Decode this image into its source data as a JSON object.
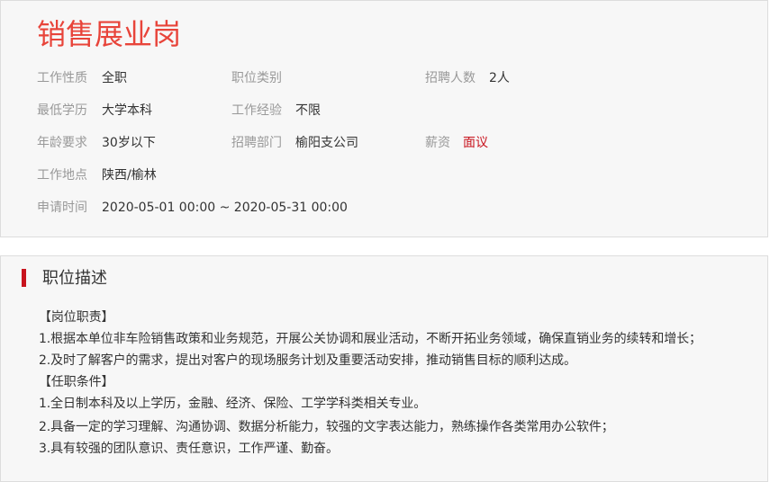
{
  "job": {
    "title": "销售展业岗",
    "fields": {
      "work_nature": {
        "label": "工作性质",
        "value": "全职"
      },
      "position_category": {
        "label": "职位类别",
        "value": ""
      },
      "headcount": {
        "label": "招聘人数",
        "value": "2人"
      },
      "education": {
        "label": "最低学历",
        "value": "大学本科"
      },
      "experience": {
        "label": "工作经验",
        "value": "不限"
      },
      "age": {
        "label": "年龄要求",
        "value": "30岁以下"
      },
      "department": {
        "label": "招聘部门",
        "value": "榆阳支公司"
      },
      "salary": {
        "label": "薪资",
        "value": "面议"
      },
      "location": {
        "label": "工作地点",
        "value": "陕西/榆林"
      },
      "apply_period": {
        "label": "申请时间",
        "value": "2020-05-01 00:00 ~ 2020-05-31 00:00"
      }
    }
  },
  "description": {
    "title": "职位描述",
    "lines": [
      "【岗位职责】",
      "1.根据本单位非车险销售政策和业务规范，开展公关协调和展业活动，不断开拓业务领域，确保直销业务的续转和增长；",
      "2.及时了解客户的需求，提出对客户的现场服务计划及重要活动安排，推动销售目标的顺利达成。",
      "【任职条件】",
      "1.全日制本科及以上学历，金融、经济、保险、工学学科类相关专业。",
      "2.具备一定的学习理解、沟通协调、数据分析能力，较强的文字表达能力，熟练操作各类常用办公软件；",
      "3.具有较强的团队意识、责任意识，工作严谨、勤奋。"
    ]
  },
  "colors": {
    "title_red": "#e8443a",
    "accent_red": "#c8141e",
    "label_gray": "#999999",
    "text_dark": "#333333",
    "panel_bg": "#f7f7f7"
  }
}
